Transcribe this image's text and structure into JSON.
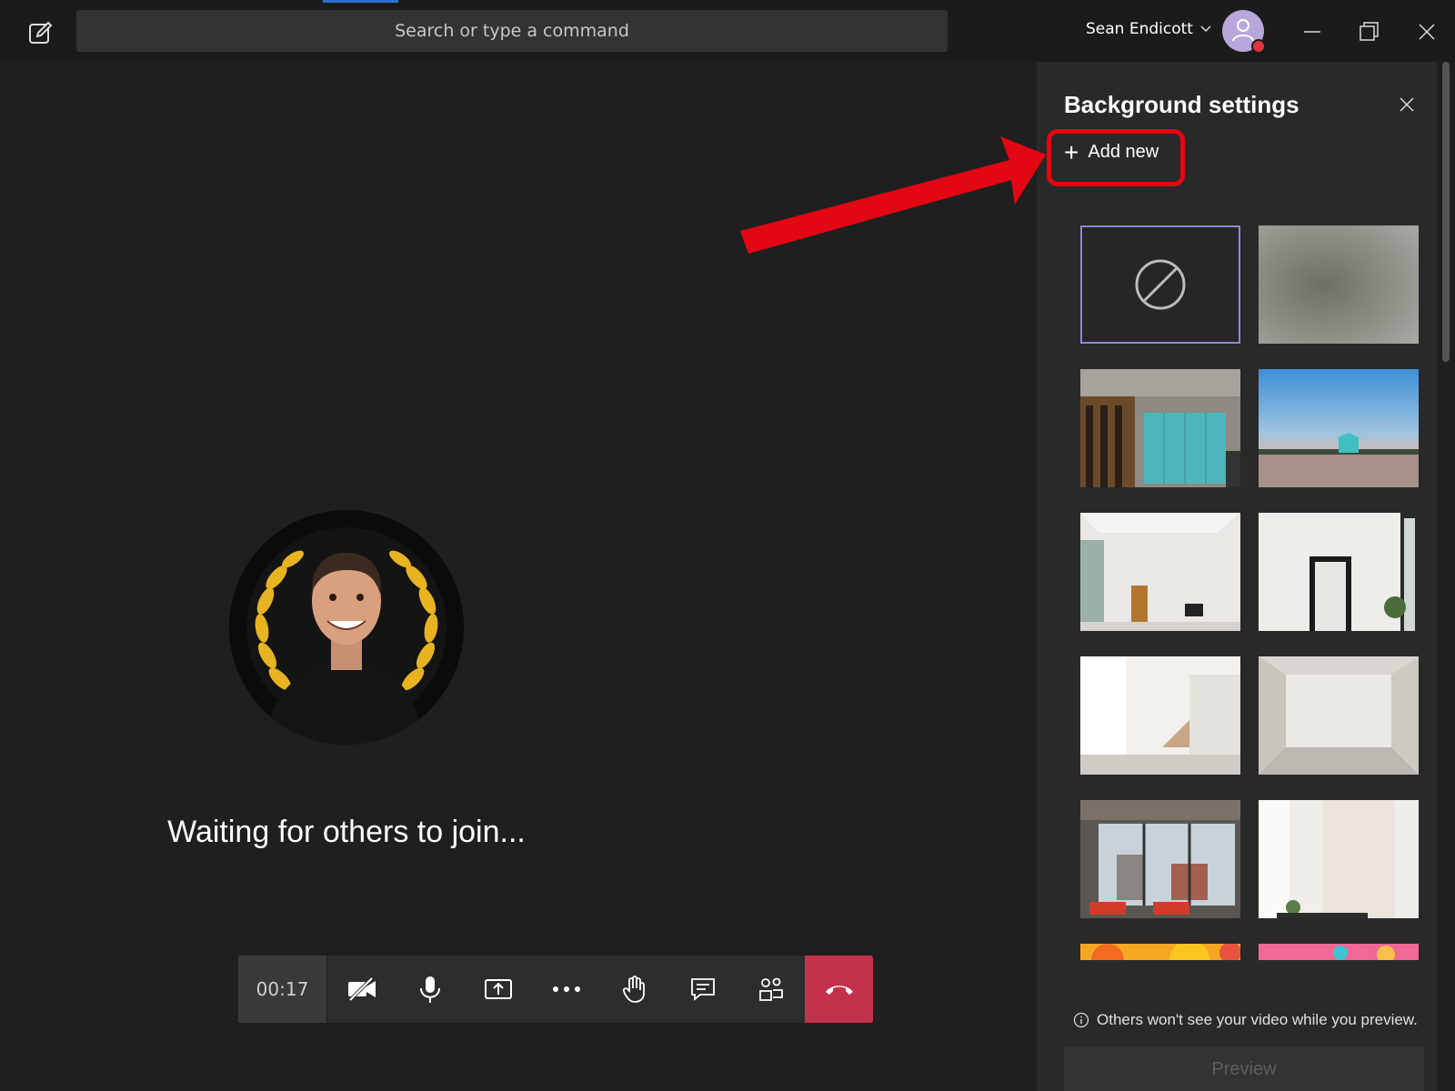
{
  "topbar": {
    "search_placeholder": "Search or type a command",
    "user_name": "Sean Endicott",
    "icons": [
      "compose-icon",
      "chevron-down-icon",
      "minimize-icon",
      "restore-icon",
      "close-icon"
    ]
  },
  "stage": {
    "waiting_text": "Waiting for others to join..."
  },
  "controls": {
    "timer": "00:17",
    "icons": [
      "camera-off-icon",
      "microphone-icon",
      "share-screen-icon",
      "more-icon",
      "raise-hand-icon",
      "chat-icon",
      "participants-icon",
      "hang-up-icon"
    ],
    "hangup_color": "#c4314b"
  },
  "panel": {
    "title": "Background settings",
    "add_new_label": "Add new",
    "info_text": "Others won't see your video while you preview.",
    "preview_label": "Preview",
    "thumbnails": [
      "none",
      "blur",
      "office-lockers",
      "beach-lifeguard",
      "white-room-window",
      "white-room-mirror",
      "white-loft-stairs",
      "white-studio",
      "city-loft",
      "white-wall-plant",
      "balloons-orange",
      "balloons-pink"
    ]
  },
  "annotation": {
    "color": "#e30613"
  }
}
